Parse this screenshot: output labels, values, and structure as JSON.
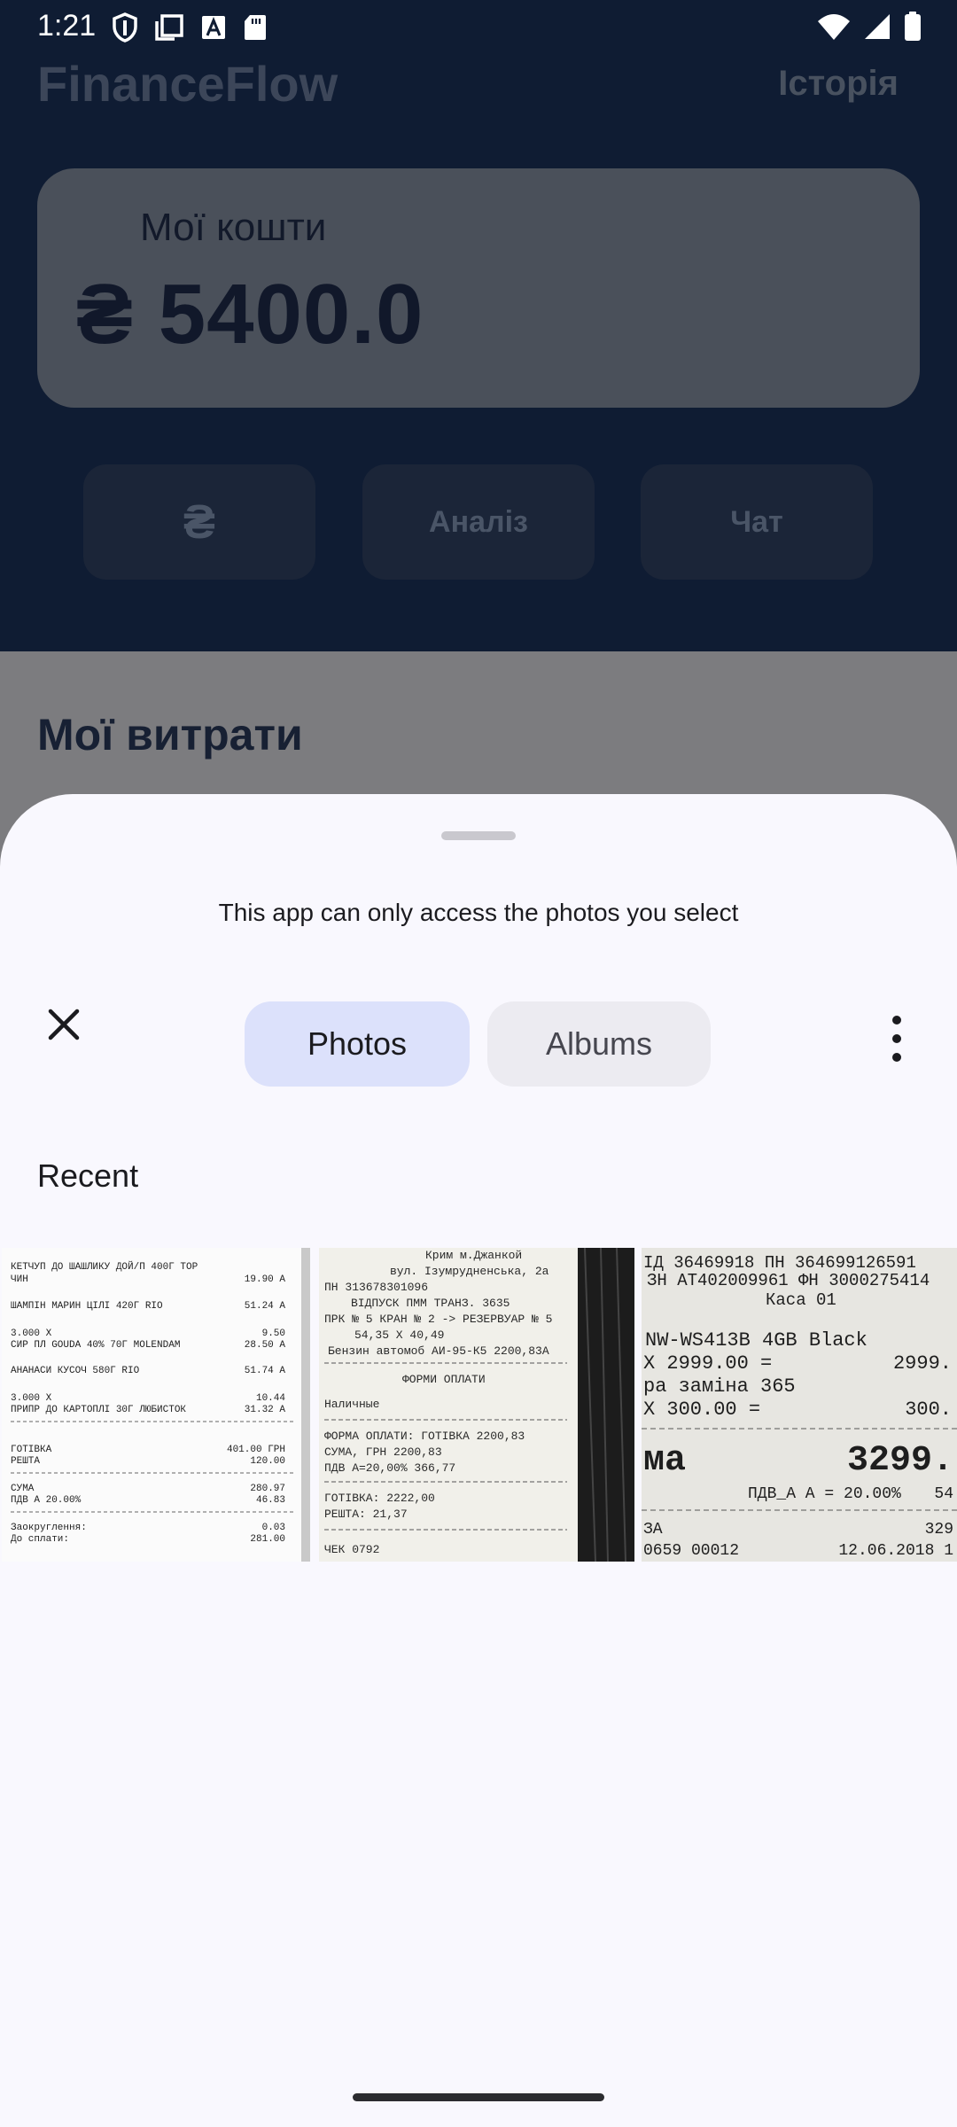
{
  "status_bar": {
    "time": "1:21"
  },
  "app": {
    "title": "FinanceFlow",
    "history_label": "Історія",
    "balance_label": "Мої кошти",
    "balance_value": "₴ 5400.0",
    "buttons": {
      "currency": "₴",
      "analysis": "Аналіз",
      "chat": "Чат"
    },
    "expenses_title": "Мої витрати"
  },
  "picker": {
    "message": "This app can only access the photos you select",
    "tabs": {
      "photos": "Photos",
      "albums": "Albums"
    },
    "section_label": "Recent",
    "photos": [
      {
        "lines": [
          "КЕТЧУП ДО ШАШЛИКУ ДОЙ/П 400Г ТОР",
          "ЧИН",
          "19.90 A",
          "ШАМПІН МАРИН ЦІЛІ 420Г RIO",
          "51.24 A",
          "3.000 X",
          "9.50",
          "СИР ПЛ GOUDA 40% 70Г MOLENDAM",
          "28.50 A",
          "АНАНАСИ КУСОЧ 580Г RIO",
          "51.74 A",
          "3.000 X",
          "10.44",
          "ПРИПР ДО КАРТОПЛІ 30Г ЛЮБИСТОК",
          "31.32 A",
          "ГОТІВКА",
          "401.00 ГРН",
          "РЕШТА",
          "120.00",
          "СУМА",
          "280.97",
          "ПДВ А 20.00%",
          "46.83",
          "Заокруглення:",
          "0.03",
          "До сплати:",
          "281.00"
        ]
      },
      {
        "lines": [
          "Крим м.Джанкой",
          "вул. Ізумрудненська, 2а",
          "ПН 313678301096",
          "ВІДПУСК ПММ ТРАНЗ. 3635",
          "ПРК № 5 КРАН № 2 -> РЕЗЕРВУАР № 5",
          "54,35 X 40,49",
          "Бензин автомоб АИ-95-К5 2200,83А",
          "ФОРМИ ОПЛАТИ",
          "Наличные",
          "ФОРМА ОПЛАТИ: ГОТІВКА 2200,83",
          "СУМА, ГРН 2200,83",
          "ПДВ А=20,00% 366,77",
          "ГОТІВКА: 2222,00",
          "РЕШТА: 21,37",
          "ЧЕК 0792"
        ]
      },
      {
        "lines": [
          "ІД 36469918 ПН 364699126591",
          "ЗН АТ402009961 ФН 3000275414",
          "Каса 01",
          "NW-WS413B 4GB Black",
          "X 2999.00 =",
          "2999.",
          "ра заміна 365",
          "X 300.00 =",
          "300.",
          "ма",
          "3299.",
          "ПДВ_А А = 20.00%",
          "54",
          "ЗА",
          "329",
          "0659 00012",
          "12.06.2018 1"
        ]
      }
    ]
  }
}
